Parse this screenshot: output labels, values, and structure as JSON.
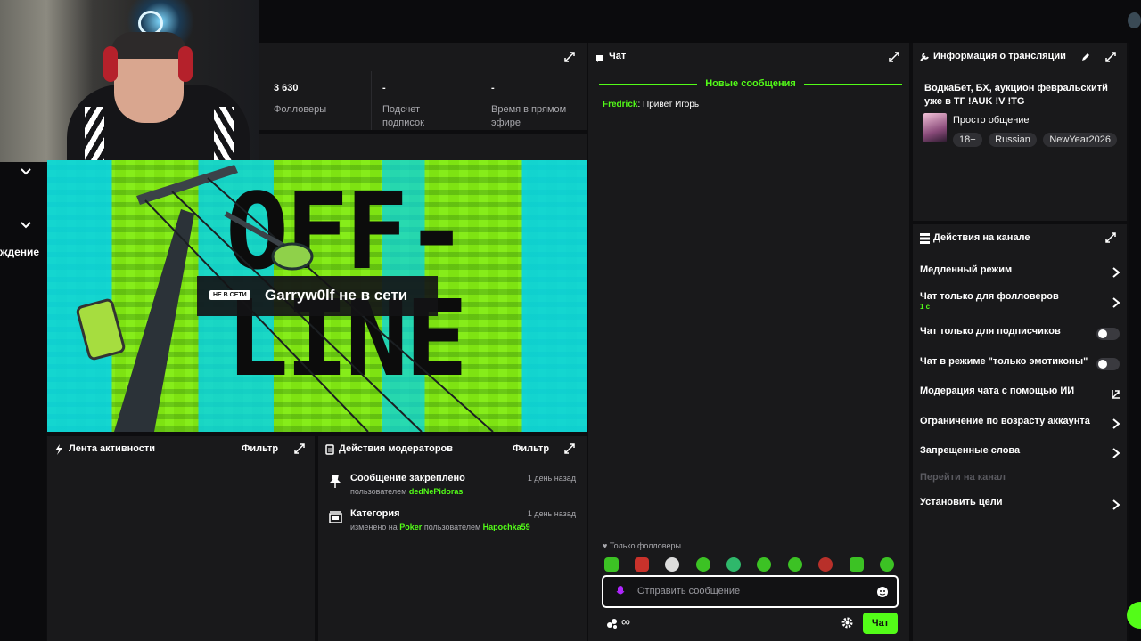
{
  "stats": [
    {
      "value": "3 630",
      "label": "Фолловеры"
    },
    {
      "value": "-",
      "label": "Подсчет подписок"
    },
    {
      "value": "-",
      "label": "Время в прямом эфире"
    }
  ],
  "left_edge": {
    "cut_text": "ждение"
  },
  "player": {
    "offline_badge": "НЕ В СЕТИ",
    "offline_text": "Garryw0lf не в сети",
    "banner_line1": "OFF-",
    "banner_line2": "LINE"
  },
  "activity_feed": {
    "title": "Лента активности",
    "filter_label": "Фильтр"
  },
  "mod_actions": {
    "title": "Действия модераторов",
    "filter_label": "Фильтр",
    "items": [
      {
        "title": "Сообщение закреплено",
        "time": "1 день назад",
        "prefix": "пользователем",
        "user": "dedNePidoras"
      },
      {
        "title": "Категория",
        "time": "1 день назад",
        "prefix": "изменено на",
        "category": "Poker",
        "middle": "пользователем",
        "user": "Hapochka59"
      }
    ]
  },
  "chat": {
    "title": "Чат",
    "new_messages": "Новые сообщения",
    "messages": [
      {
        "user": "Fredrick",
        "text": "Привет Игорь"
      }
    ],
    "followers_only": "Только фолловеры",
    "input_placeholder": "Отправить сообщение",
    "send_label": "Чат",
    "infinity": "∞"
  },
  "stream_info": {
    "title": "Информация о трансляции",
    "stream_title": "ВодкаБет, БХ, аукцион февральскитй уже в ТГ !AUK !V !TG",
    "category": "Просто общение",
    "tags": [
      "18+",
      "Russian",
      "NewYear2026"
    ]
  },
  "channel_actions": {
    "title": "Действия на канале",
    "slow_mode": "Медленный режим",
    "followers_only": "Чат только для фолловеров",
    "followers_only_value": "1 с",
    "subs_only": "Чат только для подписчиков",
    "emote_only": "Чат в режиме \"только эмотиконы\"",
    "ai_moderation": "Модерация чата с помощью ИИ",
    "account_age": "Ограничение по возрасту аккаунта",
    "banned_words": "Запрещенные слова",
    "raid": "Перейти на канал",
    "goals": "Установить цели"
  },
  "colors": {
    "accent": "#53fc18",
    "panel": "#19191b",
    "bg": "#0d0d0f"
  }
}
